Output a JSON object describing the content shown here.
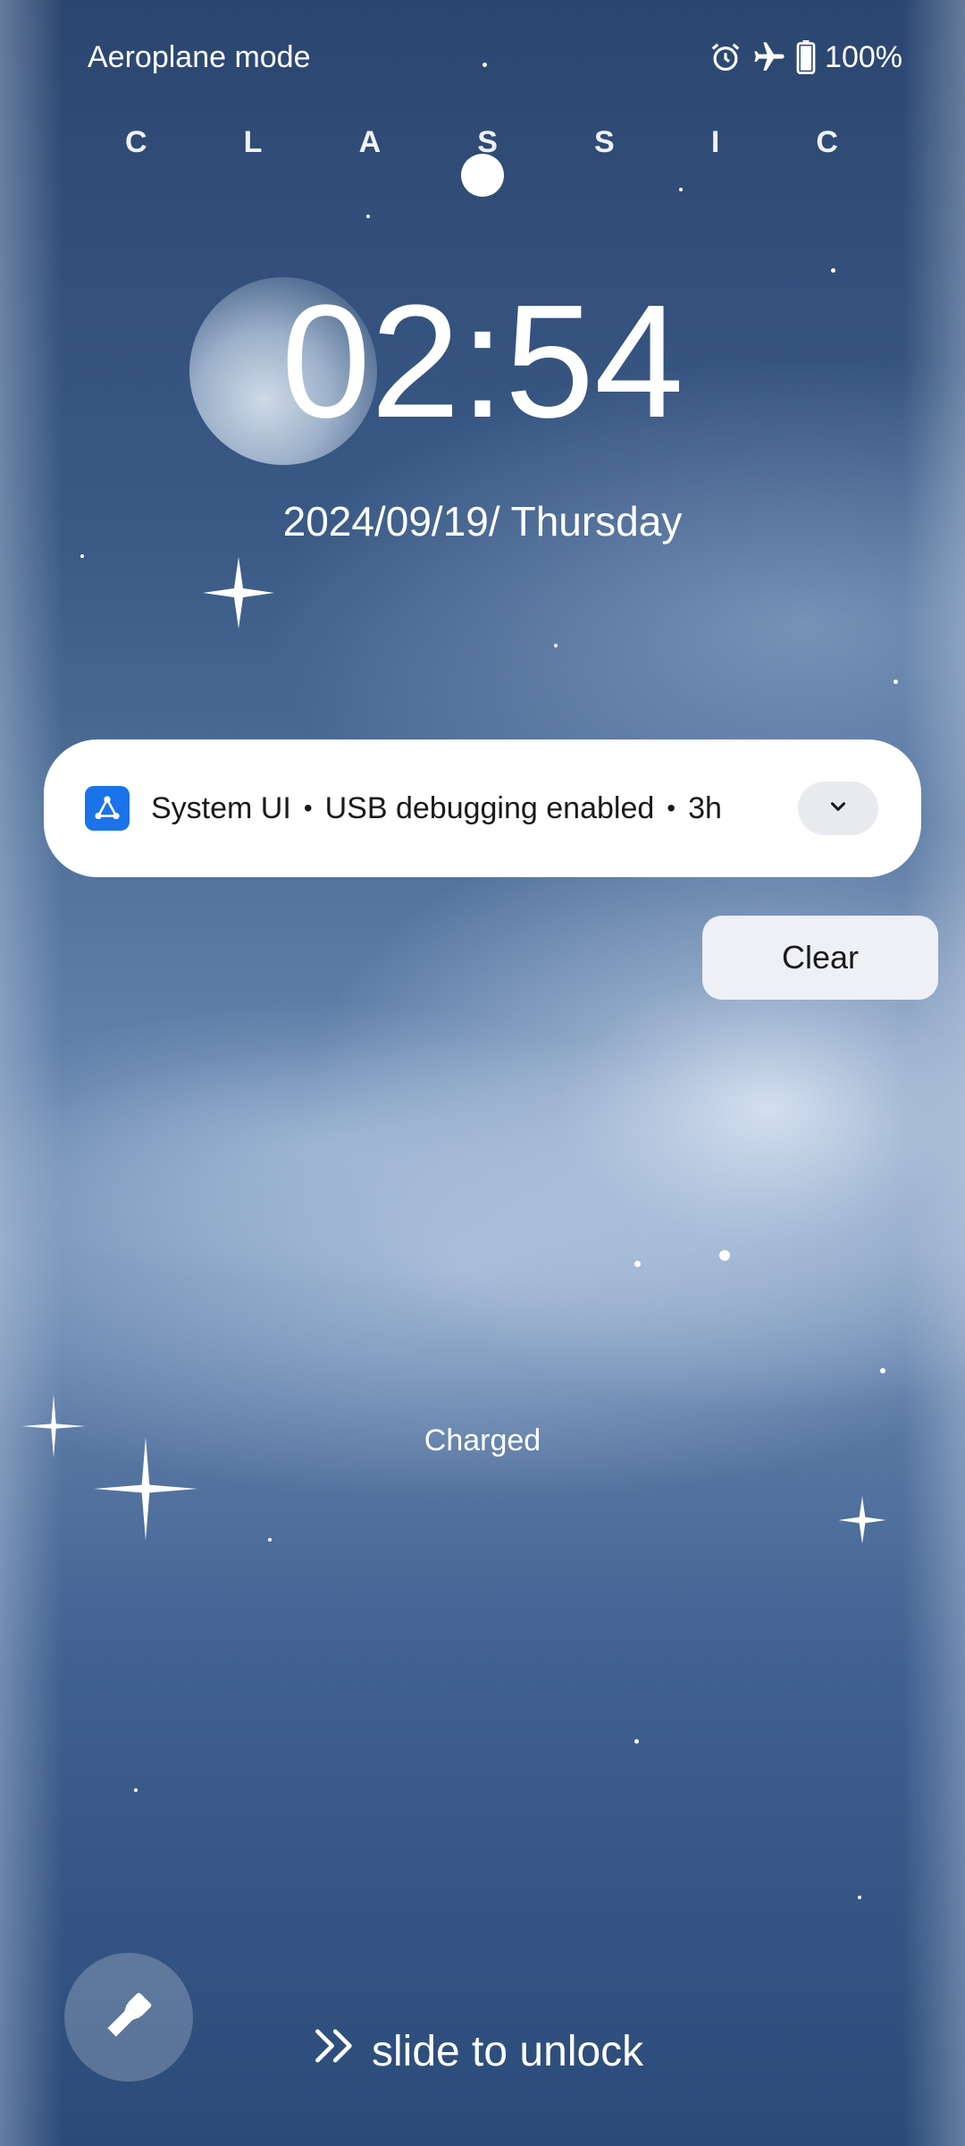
{
  "status_bar": {
    "mode_label": "Aeroplane mode",
    "battery_percent": "100%",
    "icons": [
      "alarm-icon",
      "airplane-icon",
      "battery-icon"
    ]
  },
  "brand": {
    "letters": [
      "C",
      "L",
      "A",
      "S",
      "S",
      "I",
      "C"
    ]
  },
  "lockscreen": {
    "time": "02:54",
    "date": "2024/09/19/ Thursday",
    "charging_status": "Charged"
  },
  "notification": {
    "app_name": "System UI",
    "title": "USB debugging enabled",
    "age": "3h",
    "separator": "•",
    "app_icon": "system-ui-icon",
    "expand_icon": "chevron-down-icon"
  },
  "actions": {
    "clear_label": "Clear",
    "unlock_label": "slide to unlock",
    "quick_icon": "flashlight-icon"
  },
  "colors": {
    "notification_bg": "#ffffff",
    "app_icon_bg": "#1a73e8",
    "clear_bg": "#eef0f5"
  }
}
